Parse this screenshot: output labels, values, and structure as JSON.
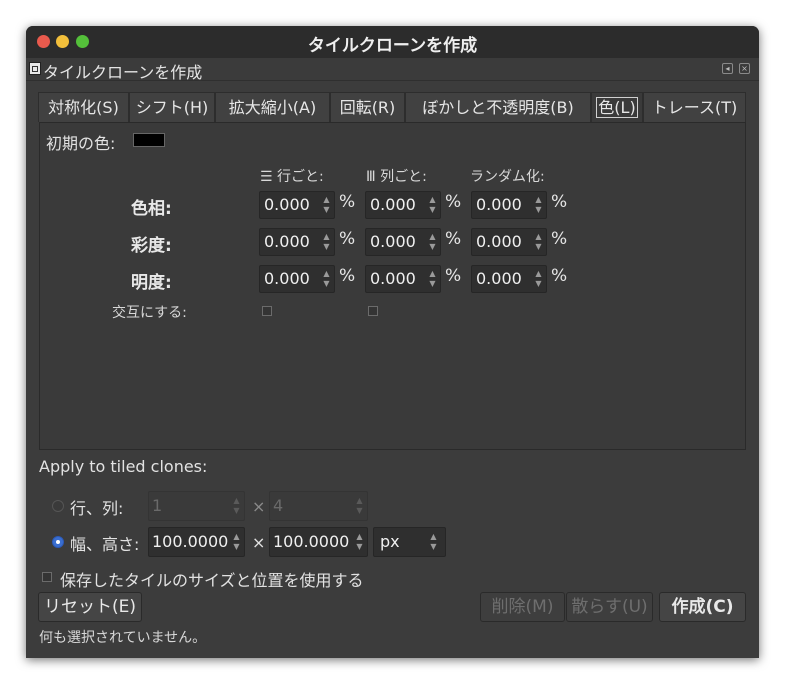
{
  "window": {
    "title": "タイルクローンを作成"
  },
  "dock": {
    "title": "タイルクローンを作成"
  },
  "tabs": [
    {
      "label": "対称化(S)"
    },
    {
      "label": "シフト(H)"
    },
    {
      "label": "拡大縮小(A)"
    },
    {
      "label": "回転(R)"
    },
    {
      "label": "ぼかしと不透明度(B)"
    },
    {
      "label": "色(L)"
    },
    {
      "label": "トレース(T)"
    }
  ],
  "active_tab": "色(L)",
  "color_tab": {
    "initial_color_label": "初期の色:",
    "initial_color": "#000000",
    "columns": {
      "per_row": "行ごと:",
      "per_col": "列ごと:",
      "random": "ランダム化:"
    },
    "rows": [
      {
        "label": "色相:",
        "per_row": "0.000",
        "per_col": "0.000",
        "random": "0.000"
      },
      {
        "label": "彩度:",
        "per_row": "0.000",
        "per_col": "0.000",
        "random": "0.000"
      },
      {
        "label": "明度:",
        "per_row": "0.000",
        "per_col": "0.000",
        "random": "0.000"
      }
    ],
    "percent": "%",
    "alternate_label": "交互にする:",
    "alternate_row": false,
    "alternate_col": false
  },
  "apply": {
    "heading": "Apply to tiled clones:",
    "rows_cols_label": "行、列:",
    "rows_value": "1",
    "cols_value": "4",
    "width_height_label": "幅、高さ:",
    "width_value": "100.0000",
    "height_value": "100.0000",
    "times": "×",
    "unit": "px",
    "selected_mode": "width_height",
    "use_saved_label": "保存したタイルのサイズと位置を使用する",
    "use_saved": false
  },
  "buttons": {
    "reset": "リセット(E)",
    "delete": "削除(M)",
    "scatter": "散らす(U)",
    "create": "作成(C)"
  },
  "status": "何も選択されていません。"
}
